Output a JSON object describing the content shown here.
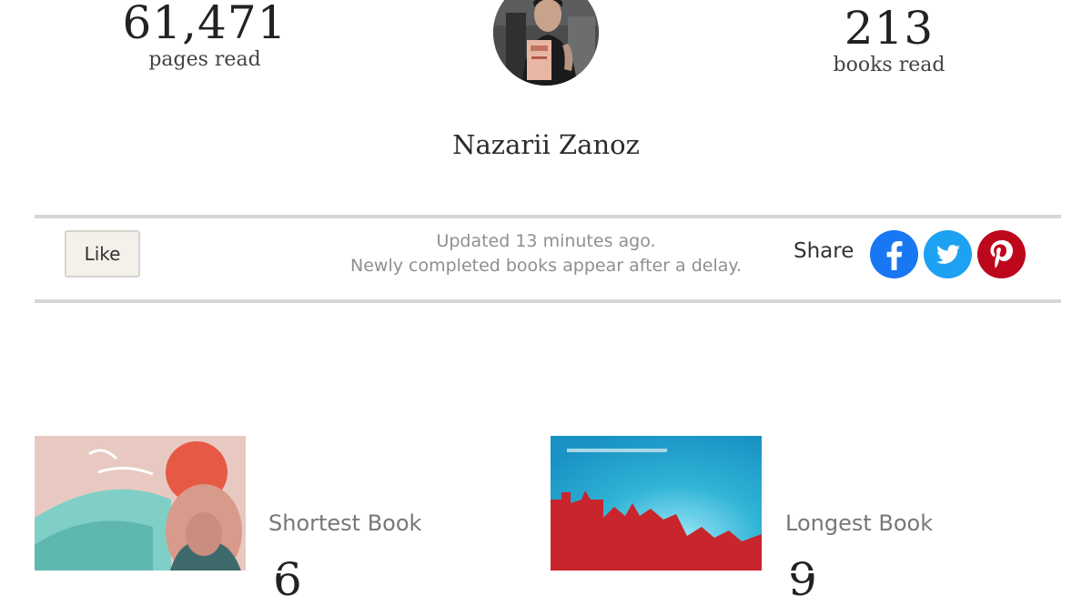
{
  "stats": {
    "pages": {
      "value": "61,471",
      "label": "pages read"
    },
    "books": {
      "value": "213",
      "label": "books read"
    }
  },
  "profile": {
    "name": "Nazarii Zanoz"
  },
  "toolbar": {
    "like_label": "Like",
    "updated_text": "Updated 13 minutes ago.",
    "delay_note": "Newly completed books appear after a delay.",
    "share_label": "Share",
    "share_icons": [
      "facebook-icon",
      "twitter-icon",
      "pinterest-icon"
    ]
  },
  "books": {
    "shortest": {
      "label": "Shortest Book",
      "value_partial": "6"
    },
    "longest": {
      "label": "Longest Book",
      "value_partial": "9"
    }
  },
  "colors": {
    "facebook": "#1877f2",
    "twitter": "#1da1f2",
    "pinterest": "#bd081c",
    "like_button_bg": "#f4f1ea",
    "muted_text": "#8f8f8f"
  }
}
